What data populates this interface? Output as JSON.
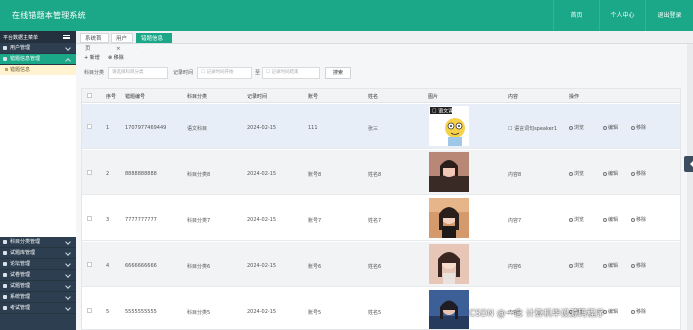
{
  "header": {
    "title": "在线错题本管理系统",
    "nav": [
      "首页",
      "个人中心",
      "退出登录"
    ]
  },
  "sidebar": {
    "top_label": "平台数据主菜单",
    "items": [
      {
        "label": "用户管理",
        "active": false
      },
      {
        "label": "错题信息管理",
        "active": true
      }
    ],
    "sub_label": "错题信息",
    "lower_items": [
      {
        "label": "科目分类管理"
      },
      {
        "label": "试题库管理"
      },
      {
        "label": "论坛管理"
      },
      {
        "label": "试卷管理"
      },
      {
        "label": "试题管理"
      },
      {
        "label": "系统管理"
      },
      {
        "label": "考试管理"
      }
    ]
  },
  "tabs": [
    {
      "label": "系统首页"
    },
    {
      "label": "用户 ×"
    },
    {
      "label": "错题信息 ×"
    }
  ],
  "toolbar": {
    "add": "+ 新增",
    "delete": "⊗ 移除"
  },
  "search": {
    "subject_label": "科目分类",
    "subject_placeholder": "请选择科目分类",
    "time_label": "记录时间",
    "start_placeholder": "☐ 记录时间开始",
    "to": "至",
    "end_placeholder": "☐ 记录时间结束",
    "button": "搜索"
  },
  "table": {
    "columns": [
      "序号",
      "错题编号",
      "科目分类",
      "记录时间",
      "账号",
      "姓名",
      "图片",
      "内容",
      "操作"
    ],
    "rows": [
      {
        "no": "1",
        "code": "1707977469449",
        "subject": "语文科目",
        "time": "2024-02-15",
        "account": "111",
        "name": "张三",
        "content": "☐ 语言词句speaker1",
        "pic": "cartoon"
      },
      {
        "no": "2",
        "code": "8888888888",
        "subject": "科目分类8",
        "time": "2024-02-15",
        "account": "账号8",
        "name": "姓名8",
        "content": "内容8",
        "pic": "photo1"
      },
      {
        "no": "3",
        "code": "7777777777",
        "subject": "科目分类7",
        "time": "2024-02-15",
        "account": "账号7",
        "name": "姓名7",
        "content": "内容7",
        "pic": "photo2"
      },
      {
        "no": "4",
        "code": "6666666666",
        "subject": "科目分类6",
        "time": "2024-02-15",
        "account": "账号6",
        "name": "姓名6",
        "content": "内容6",
        "pic": "photo3"
      },
      {
        "no": "5",
        "code": "5555555555",
        "subject": "科目分类5",
        "time": "2024-02-15",
        "account": "账号5",
        "name": "姓名5",
        "content": "内容5",
        "pic": "photo4"
      }
    ],
    "actions": [
      "浏览",
      "编辑",
      "移除"
    ]
  },
  "watermark": "CSDN @一念 计算机毕设源码程序",
  "colors": {
    "brand": "#1ba888",
    "sidebar": "#2d3e50"
  }
}
